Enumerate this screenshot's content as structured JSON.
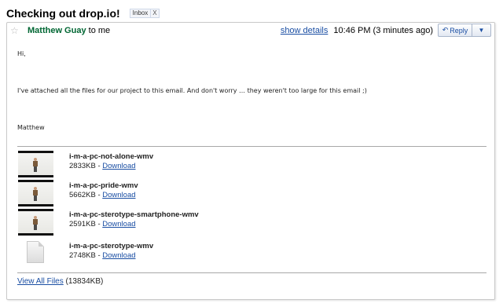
{
  "subject": "Checking out drop.io!",
  "label": {
    "name": "Inbox",
    "remove": "X"
  },
  "header": {
    "sender_name": "Matthew Guay",
    "to_text": "to me",
    "show_details": "show details",
    "time": "10:46 PM (3 minutes ago)",
    "reply_label": "Reply",
    "reply_arrow": "↶",
    "menu_arrow": "▼"
  },
  "body": {
    "greeting": "Hi,",
    "message": "I've attached all the files for our project to this email.  And don't worry … they weren't too large for this email ;)",
    "signature": "Matthew"
  },
  "attachments": [
    {
      "name": "i-m-a-pc-not-alone-wmv",
      "size": "2833KB",
      "sep": " - ",
      "link": "Download",
      "icon": "video-thumbnail"
    },
    {
      "name": "i-m-a-pc-pride-wmv",
      "size": "5662KB",
      "sep": " - ",
      "link": "Download",
      "icon": "video-thumbnail"
    },
    {
      "name": "i-m-a-pc-sterotype-smartphone-wmv",
      "size": "2591KB",
      "sep": " - ",
      "link": "Download",
      "icon": "video-thumbnail"
    },
    {
      "name": "i-m-a-pc-sterotype-wmv",
      "size": "2748KB",
      "sep": " - ",
      "link": "Download",
      "icon": "generic-file"
    }
  ],
  "view_all": {
    "link": "View All Files",
    "total": " (13834KB)"
  },
  "colors": {
    "sender": "#006633",
    "link": "#1a4ea3"
  }
}
